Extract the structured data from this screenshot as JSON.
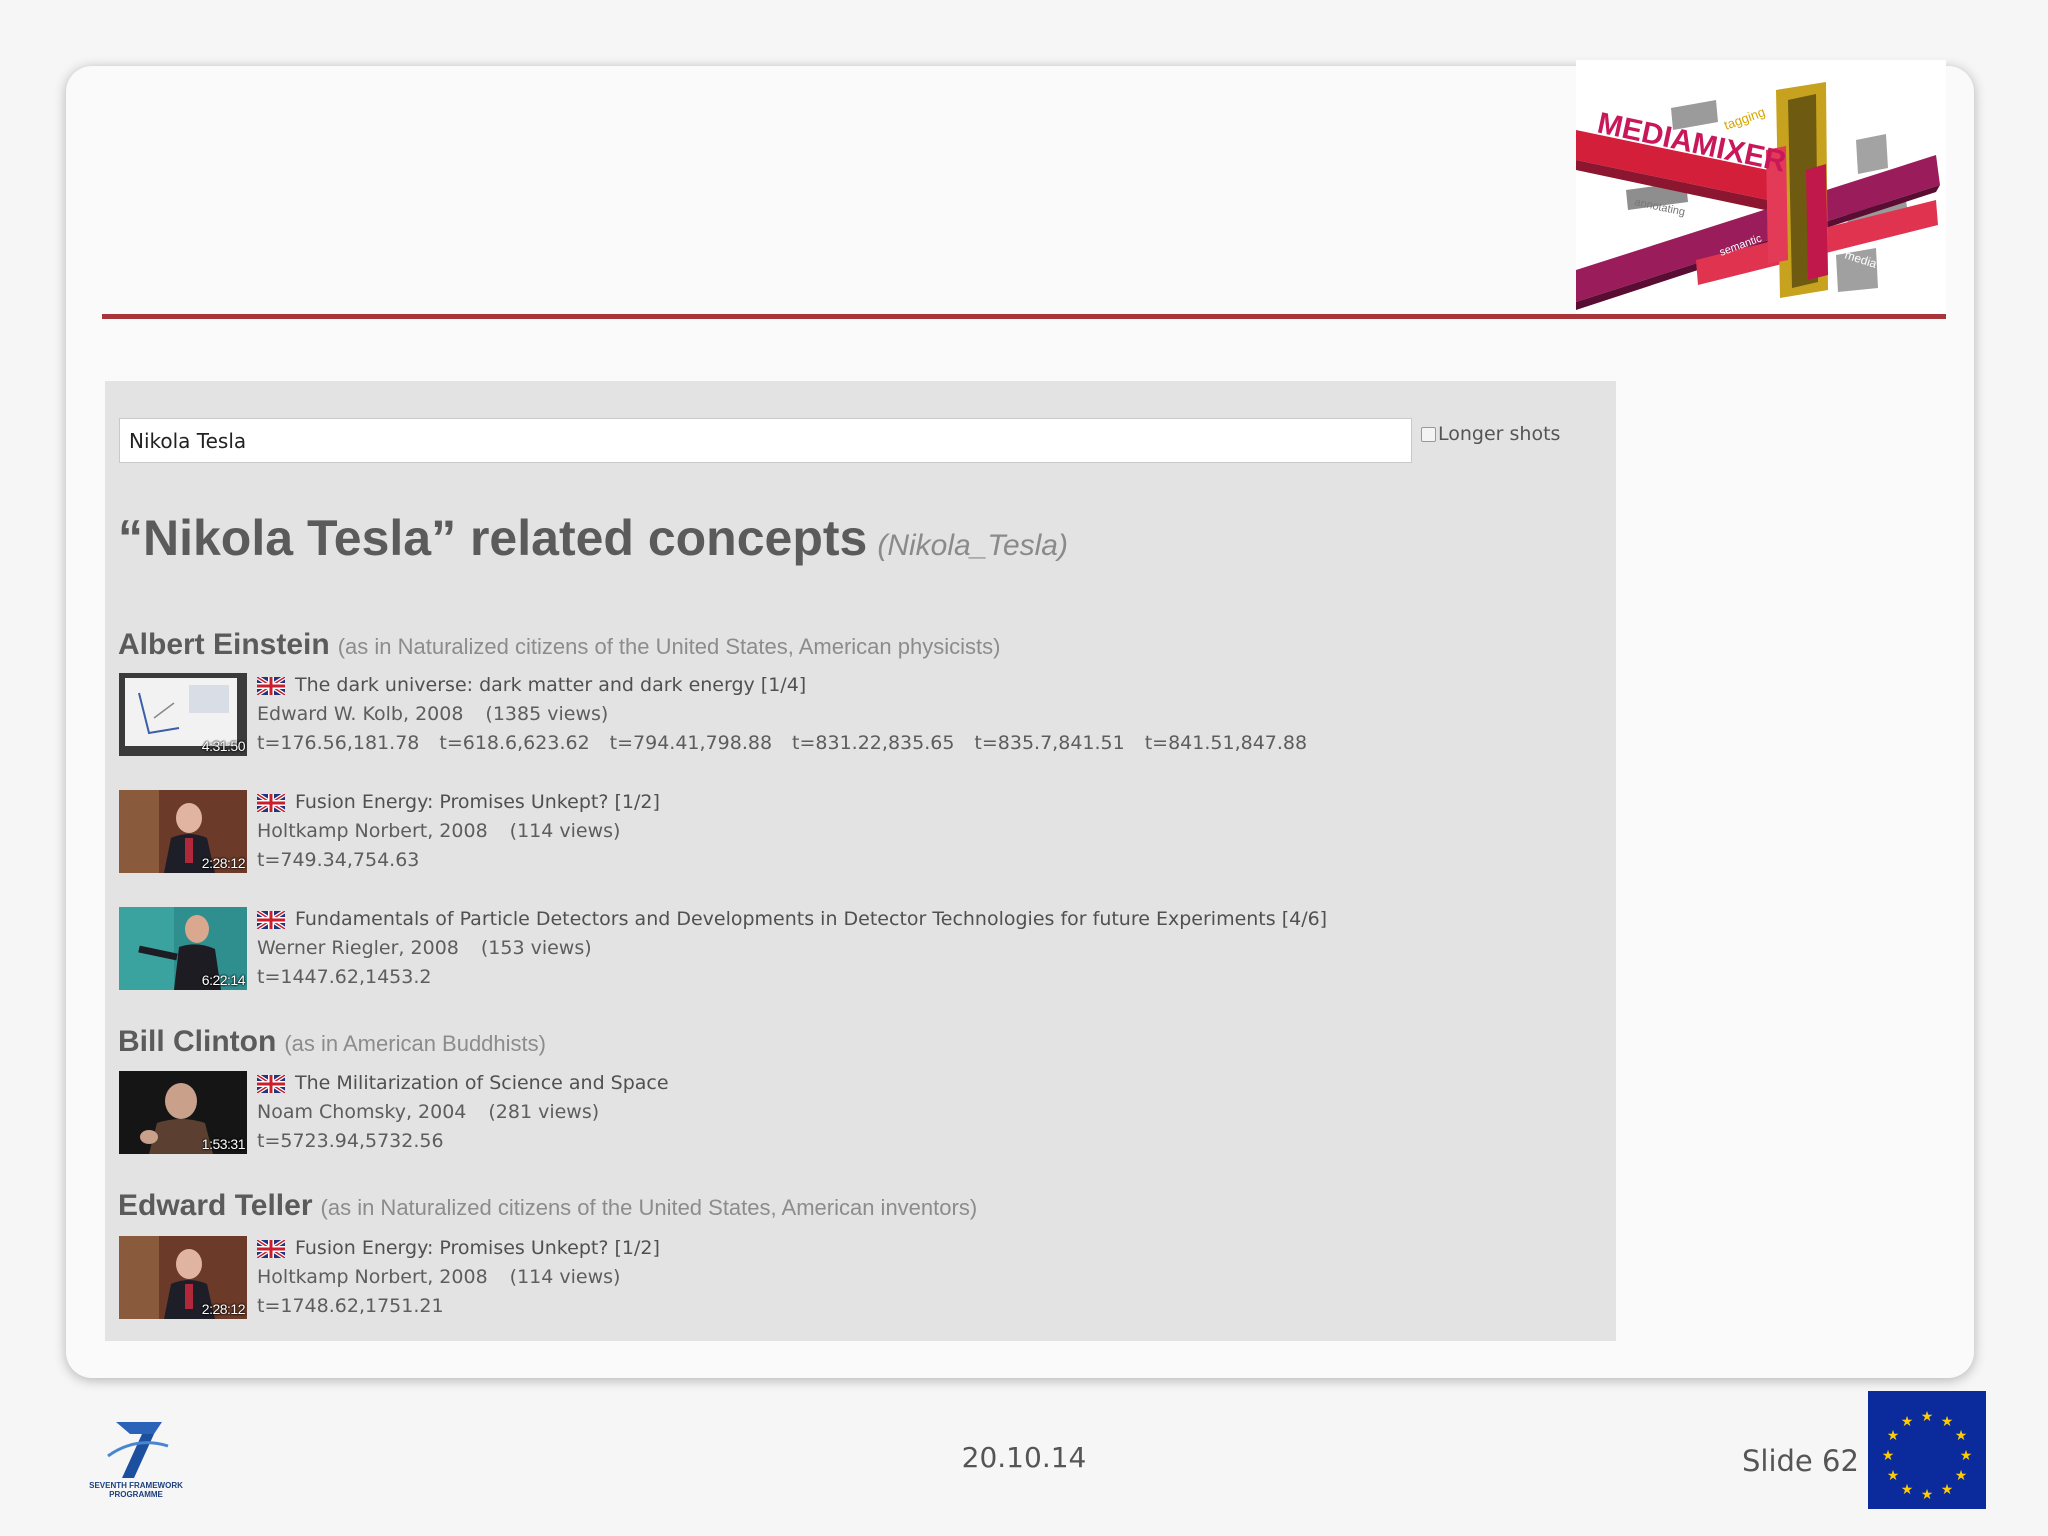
{
  "search": {
    "value": "Nikola Tesla"
  },
  "options": {
    "longer_shots_label": "Longer shots",
    "longer_shots_checked": false
  },
  "heading": {
    "title": "“Nikola Tesla” related concepts",
    "entity_id": "(Nikola_Tesla)"
  },
  "concepts": [
    {
      "name": "Albert Einstein",
      "context": "(as in Naturalized citizens of the United States, American physicists)",
      "videos": [
        {
          "title": "The dark universe: dark matter and dark energy [1/4]",
          "author_year": "Edward W. Kolb, 2008",
          "views": "(1385 views)",
          "duration": "4:31:50",
          "thumb": "slide",
          "timecodes": [
            "t=176.56,181.78",
            "t=618.6,623.62",
            "t=794.41,798.88",
            "t=831.22,835.65",
            "t=835.7,841.51",
            "t=841.51,847.88"
          ]
        }
      ]
    },
    {
      "name": "",
      "context": "",
      "videos": [
        {
          "title": "Fusion Energy: Promises Unkept? [1/2]",
          "author_year": "Holtkamp Norbert, 2008",
          "views": "(114 views)",
          "duration": "2:28:12",
          "thumb": "speaker-red",
          "timecodes": [
            "t=749.34,754.63"
          ]
        },
        {
          "title": "Fundamentals of Particle Detectors and Developments in Detector Technologies for future Experiments [4/6]",
          "author_year": "Werner Riegler, 2008",
          "views": "(153 views)",
          "duration": "6:22:14",
          "thumb": "speaker-teal",
          "timecodes": [
            "t=1447.62,1453.2"
          ]
        }
      ]
    },
    {
      "name": "Bill Clinton",
      "context": "(as in American Buddhists)",
      "videos": [
        {
          "title": "The Militarization of Science and Space",
          "author_year": "Noam Chomsky, 2004",
          "views": "(281 views)",
          "duration": "1:53:31",
          "thumb": "speaker-dark",
          "timecodes": [
            "t=5723.94,5732.56"
          ]
        }
      ]
    },
    {
      "name": "Edward Teller",
      "context": "(as in Naturalized citizens of the United States, American inventors)",
      "videos": [
        {
          "title": "Fusion Energy: Promises Unkept? [1/2]",
          "author_year": "Holtkamp Norbert, 2008",
          "views": "(114 views)",
          "duration": "2:28:12",
          "thumb": "speaker-red",
          "timecodes": [
            "t=1748.62,1751.21"
          ]
        }
      ]
    }
  ],
  "logo": {
    "brand": "MEDIAMIXER",
    "words": [
      "tagging",
      "annotating",
      "semantic",
      "media"
    ]
  },
  "fp7_logo": {
    "line1": "SEVENTH FRAMEWORK",
    "line2": "PROGRAMME"
  },
  "footer": {
    "date": "20.10.14",
    "slide": "Slide 62"
  },
  "colors": {
    "rule": "#a8343c",
    "logo_magenta": "#c8185a",
    "eu_blue": "#0b2a9c",
    "eu_star": "#ffcc00"
  }
}
